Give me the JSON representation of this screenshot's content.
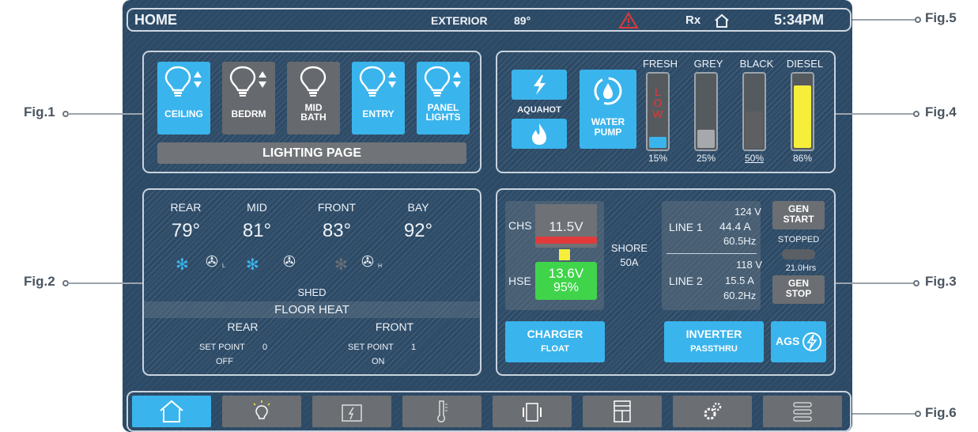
{
  "topbar": {
    "title": "HOME",
    "exterior_label": "EXTERIOR",
    "exterior_temp": "89°",
    "rx": "Rx",
    "time": "5:34PM"
  },
  "lighting": {
    "buttons": [
      {
        "label": "CEILING",
        "active": true,
        "dimmer": true
      },
      {
        "label": "BEDRM",
        "active": false,
        "dimmer": true
      },
      {
        "label": "MID\nBATH",
        "active": false,
        "dimmer": false
      },
      {
        "label": "ENTRY",
        "active": true,
        "dimmer": true
      },
      {
        "label": "PANEL\nLIGHTS",
        "active": true,
        "dimmer": true
      }
    ],
    "page_button": "LIGHTING PAGE"
  },
  "tanks": {
    "aquahot_label": "AQUAHOT",
    "water_pump_label": "WATER\nPUMP",
    "items": [
      {
        "name": "FRESH",
        "percent": "15%",
        "level": 0.15,
        "color": "#3ab4ec",
        "warning": "LOW"
      },
      {
        "name": "GREY",
        "percent": "25%",
        "level": 0.25,
        "color": "#a6a9ac"
      },
      {
        "name": "BLACK",
        "percent": "50%",
        "level": 0.5,
        "color": "#5e5f61"
      },
      {
        "name": "DIESEL",
        "percent": "86%",
        "level": 0.86,
        "color": "#f5ee3a"
      }
    ]
  },
  "climate": {
    "zones": [
      {
        "name": "REAR",
        "temp": "79°"
      },
      {
        "name": "MID",
        "temp": "81°"
      },
      {
        "name": "FRONT",
        "temp": "83°"
      },
      {
        "name": "BAY",
        "temp": "92°"
      }
    ],
    "fan_l": "L",
    "fan_h": "H",
    "shed": "SHED",
    "floor_heat_title": "FLOOR HEAT",
    "floor_rear": {
      "name": "REAR",
      "set_point_label": "SET POINT",
      "set_point": "0",
      "state": "OFF"
    },
    "floor_front": {
      "name": "FRONT",
      "set_point_label": "SET POINT",
      "set_point": "1",
      "state": "ON"
    }
  },
  "power": {
    "chs_label": "CHS",
    "chs_voltage": "11.5V",
    "hse_label": "HSE",
    "hse_voltage": "13.6V",
    "hse_percent": "95%",
    "shore_label": "SHORE",
    "shore_amps": "50A",
    "line1": {
      "label": "LINE 1",
      "volts": "124 V",
      "amps": "44.4 A",
      "hz": "60.5Hz"
    },
    "line2": {
      "label": "LINE 2",
      "volts": "118 V",
      "amps": "15.5 A",
      "hz": "60.2Hz"
    },
    "gen_start": "GEN\nSTART",
    "gen_status": "STOPPED",
    "gen_hours": "21.0Hrs",
    "gen_stop": "GEN\nSTOP",
    "charger_label": "CHARGER",
    "charger_state": "FLOAT",
    "inverter_label": "INVERTER",
    "inverter_state": "PASSTHRU",
    "ags_label": "AGS"
  },
  "nav": {
    "items": [
      "home-icon",
      "lightbulb-icon",
      "battery-icon",
      "thermometer-icon",
      "generator-icon",
      "slides-icon",
      "gears-icon",
      "settings-sliders-icon"
    ]
  },
  "figures": {
    "fig1": "Fig.1",
    "fig2": "Fig.2",
    "fig3": "Fig.3",
    "fig4": "Fig.4",
    "fig5": "Fig.5",
    "fig6": "Fig.6"
  },
  "colors": {
    "accent": "#3ab4ec",
    "screen_bg": "#2c4a66",
    "warning": "#e03a3a",
    "battery_ok": "#3fd44a"
  }
}
